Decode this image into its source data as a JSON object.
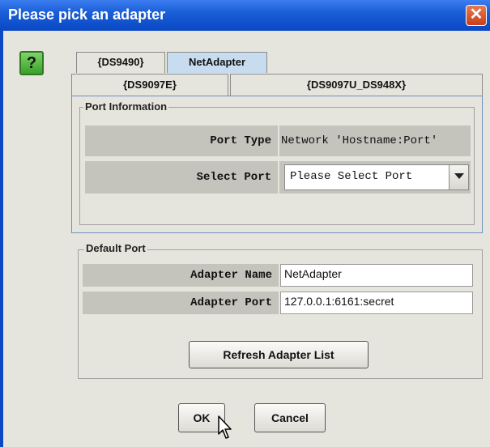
{
  "window": {
    "title": "Please pick an adapter",
    "close_icon": "close-icon",
    "close_glyph": "✕"
  },
  "help_icon": {
    "name": "question-icon",
    "glyph": "?"
  },
  "tabs": {
    "row1": [
      "{DS9490}",
      "NetAdapter"
    ],
    "row2": [
      "{DS9097E}",
      "{DS9097U_DS948X}"
    ],
    "active": "NetAdapter"
  },
  "port_information": {
    "title": "Port Information",
    "port_type_label": "Port Type",
    "port_type_value": "Network 'Hostname:Port'",
    "select_port_label": "Select Port",
    "select_port_value": "Please Select Port"
  },
  "default_port": {
    "title": "Default Port",
    "adapter_name_label": "Adapter Name",
    "adapter_name_value": "NetAdapter",
    "adapter_port_label": "Adapter Port",
    "adapter_port_value": "127.0.0.1:6161:secret",
    "refresh_button": "Refresh Adapter List"
  },
  "buttons": {
    "ok": "OK",
    "cancel": "Cancel"
  },
  "colors": {
    "titlebar": "#0a48c4",
    "active_tab": "#c8dcf0",
    "help_icon": "#3aa02a"
  }
}
